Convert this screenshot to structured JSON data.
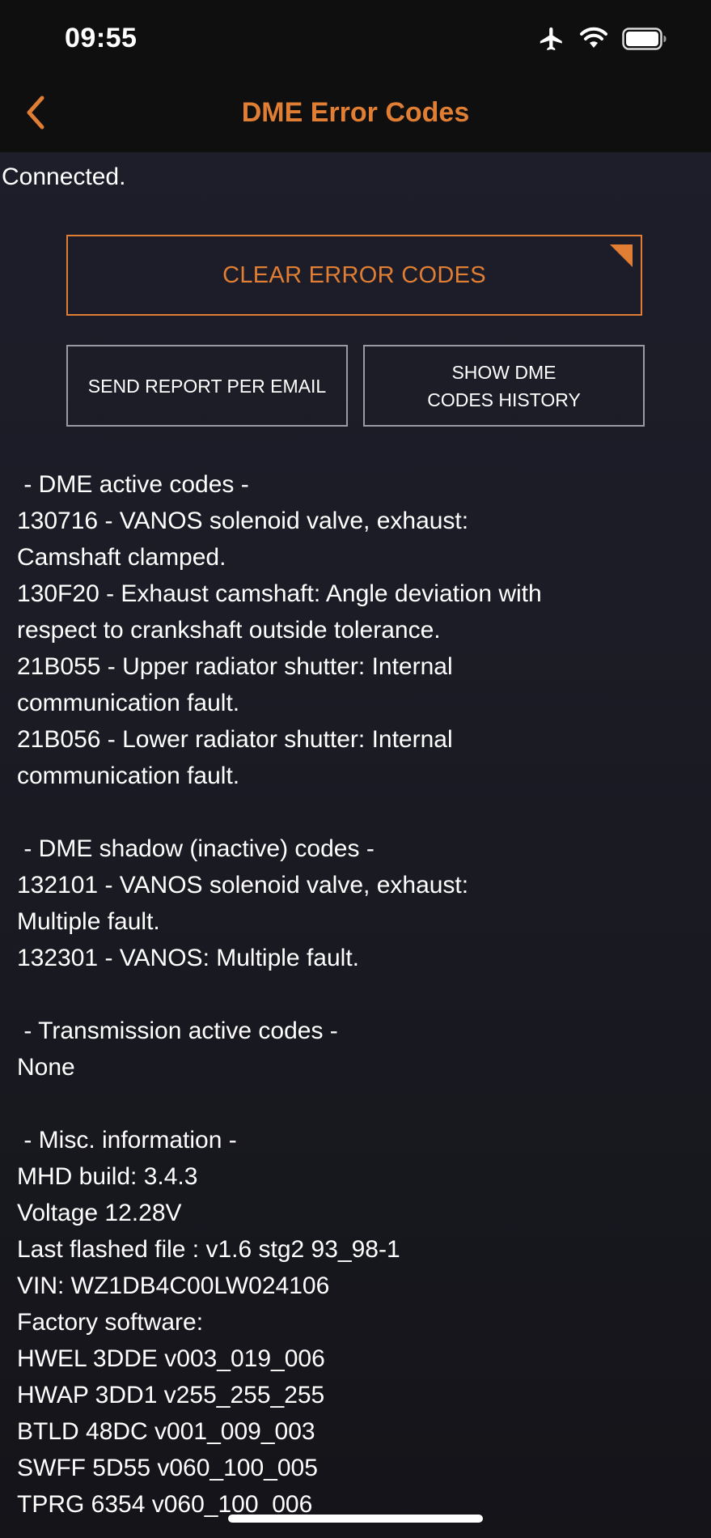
{
  "status_bar": {
    "time": "09:55",
    "icons": [
      "airplane-icon",
      "wifi-icon",
      "battery-icon"
    ]
  },
  "nav": {
    "title": "DME Error Codes",
    "back_icon": "chevron-left-icon"
  },
  "connection_status": "Connected.",
  "buttons": {
    "clear": "CLEAR ERROR CODES",
    "send_report": "SEND REPORT PER EMAIL",
    "history_line1": "SHOW DME",
    "history_line2": "CODES HISTORY"
  },
  "report_lines": [
    " - DME active codes -",
    "130716 - VANOS solenoid valve, exhaust:",
    "Camshaft clamped.",
    "130F20 - Exhaust camshaft: Angle deviation with",
    "respect to crankshaft outside tolerance.",
    "21B055 - Upper radiator shutter: Internal",
    "communication fault.",
    "21B056 - Lower radiator shutter: Internal",
    "communication fault.",
    "",
    " - DME shadow (inactive) codes -",
    "132101 - VANOS solenoid valve, exhaust:",
    "Multiple fault.",
    "132301 - VANOS: Multiple fault.",
    "",
    " - Transmission active codes -",
    "None",
    "",
    " - Misc. information -",
    "MHD build: 3.4.3",
    "Voltage 12.28V",
    "Last flashed file : v1.6 stg2 93_98-1",
    "VIN: WZ1DB4C00LW024106",
    "Factory software:",
    "HWEL 3DDE v003_019_006",
    "HWAP 3DD1 v255_255_255",
    "BTLD 48DC v001_009_003",
    "SWFF 5D55 v060_100_005",
    "TPRG 6354 v060_100_006"
  ],
  "colors": {
    "accent": "#e07e33",
    "background": "#1c1c26",
    "bar_background": "#0f0f10",
    "button_border": "#9a9aa2"
  }
}
